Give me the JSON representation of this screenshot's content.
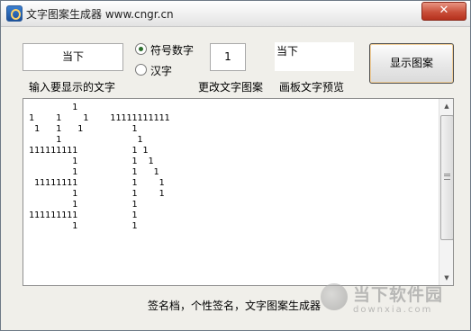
{
  "window": {
    "title": "文字图案生成器 www.cngr.cn",
    "close_label": "✕"
  },
  "controls": {
    "input_text": "当下",
    "input_caption": "输入要显示的文字",
    "radio_symbol_label": "符号数字",
    "radio_hanzi_label": "汉字",
    "selected_mode": "符号数字",
    "pattern_char": "1",
    "pattern_char_caption": "更改文字图案",
    "preview_text": "当下",
    "preview_caption": "画板文字预览",
    "show_button_label": "显示图案"
  },
  "output": {
    "pattern_lines": [
      "        1",
      "1    1    1    11111111111",
      " 1   1   1         1",
      "     1              1",
      "111111111          1 1",
      "        1          1  1",
      "        1          1   1",
      " 11111111          1    1",
      "        1          1    1",
      "        1          1",
      "111111111          1",
      "        1          1"
    ]
  },
  "footer": {
    "text": "签名档，个性签名，文字图案生成器"
  },
  "watermark": {
    "main": "当下软件园",
    "sub": "downxia.com"
  }
}
